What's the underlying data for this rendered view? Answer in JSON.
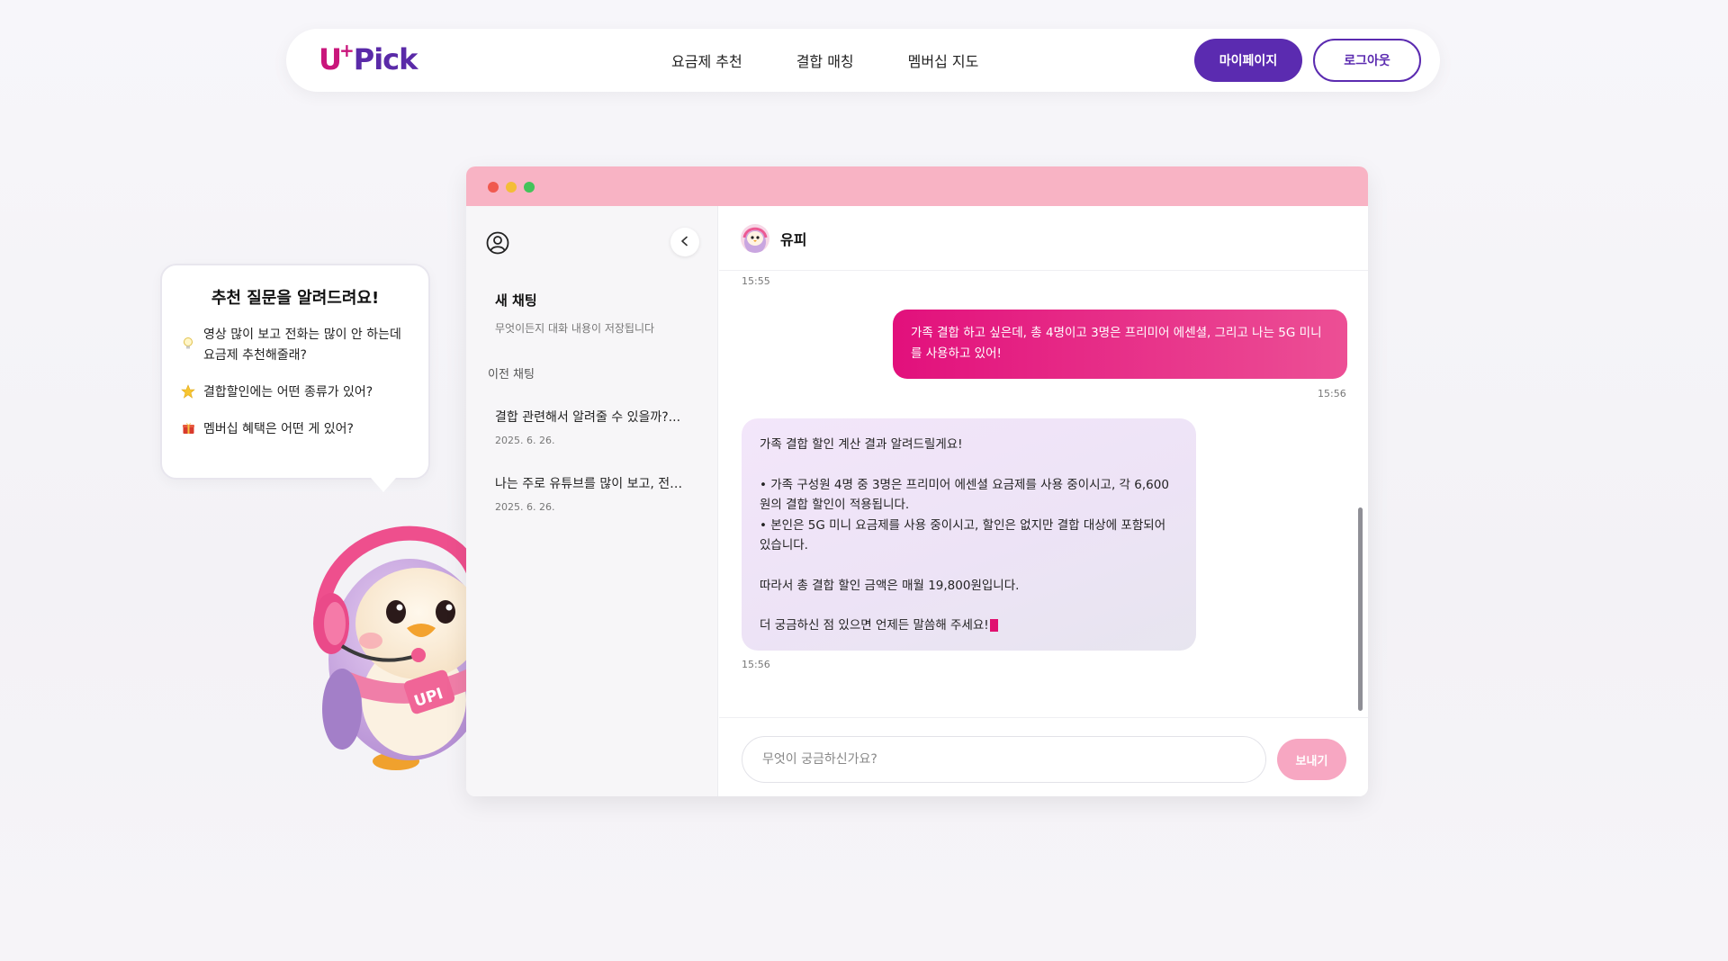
{
  "brand": {
    "logo_main": "U",
    "logo_plus": "+",
    "logo_tail": "Pick",
    "primary_color": "#5b2bb0",
    "accent_color": "#e2107c"
  },
  "nav": {
    "links": [
      "요금제 추천",
      "결합 매칭",
      "멤버십 지도"
    ],
    "mypage_label": "마이페이지",
    "logout_label": "로그아웃"
  },
  "recommend": {
    "title": "추천 질문을 알려드려요!",
    "items": [
      {
        "icon": "lightbulb-icon",
        "text": "영상 많이 보고 전화는 많이 안 하는데 요금제 추천해줄래?"
      },
      {
        "icon": "star-icon",
        "text": "결합할인에는 어떤 종류가 있어?"
      },
      {
        "icon": "gift-icon",
        "text": "멤버십 혜택은 어떤 게 있어?"
      }
    ]
  },
  "sidebar": {
    "new_chat_title": "새 채팅",
    "new_chat_sub": "무엇이든지 대화 내용이 저장됩니다",
    "prev_label": "이전 채팅",
    "history": [
      {
        "title": "결합 관련해서 알려줄 수 있을까?...",
        "date": "2025. 6. 26."
      },
      {
        "title": "나는 주로 유튜브를 많이 보고, 전…",
        "date": "2025. 6. 26."
      }
    ]
  },
  "chat": {
    "bot_name": "유피",
    "time_top": "15:55",
    "user_message": "가족 결합 하고 싶은데, 총 4명이고 3명은 프리미어 에센셜, 그리고 나는 5G 미니를 사용하고 있어!",
    "user_time": "15:56",
    "bot_lines": {
      "intro": "가족 결합 할인 계산 결과 알려드릴게요!",
      "b1": "• 가족 구성원 4명 중 3명은 프리미어 에센셜 요금제를 사용 중이시고, 각 6,600원의 결합 할인이 적용됩니다.",
      "b2": "• 본인은 5G 미니 요금제를 사용 중이시고, 할인은 없지만 결합 대상에 포함되어 있습니다.",
      "total": "따라서 총 결합 할인 금액은 매월 19,800원입니다.",
      "outro": "더 궁금하신 점 있으면 언제든 말씀해 주세요!"
    },
    "bot_time": "15:56",
    "input_placeholder": "무엇이 궁금하신가요?",
    "send_label": "보내기"
  }
}
